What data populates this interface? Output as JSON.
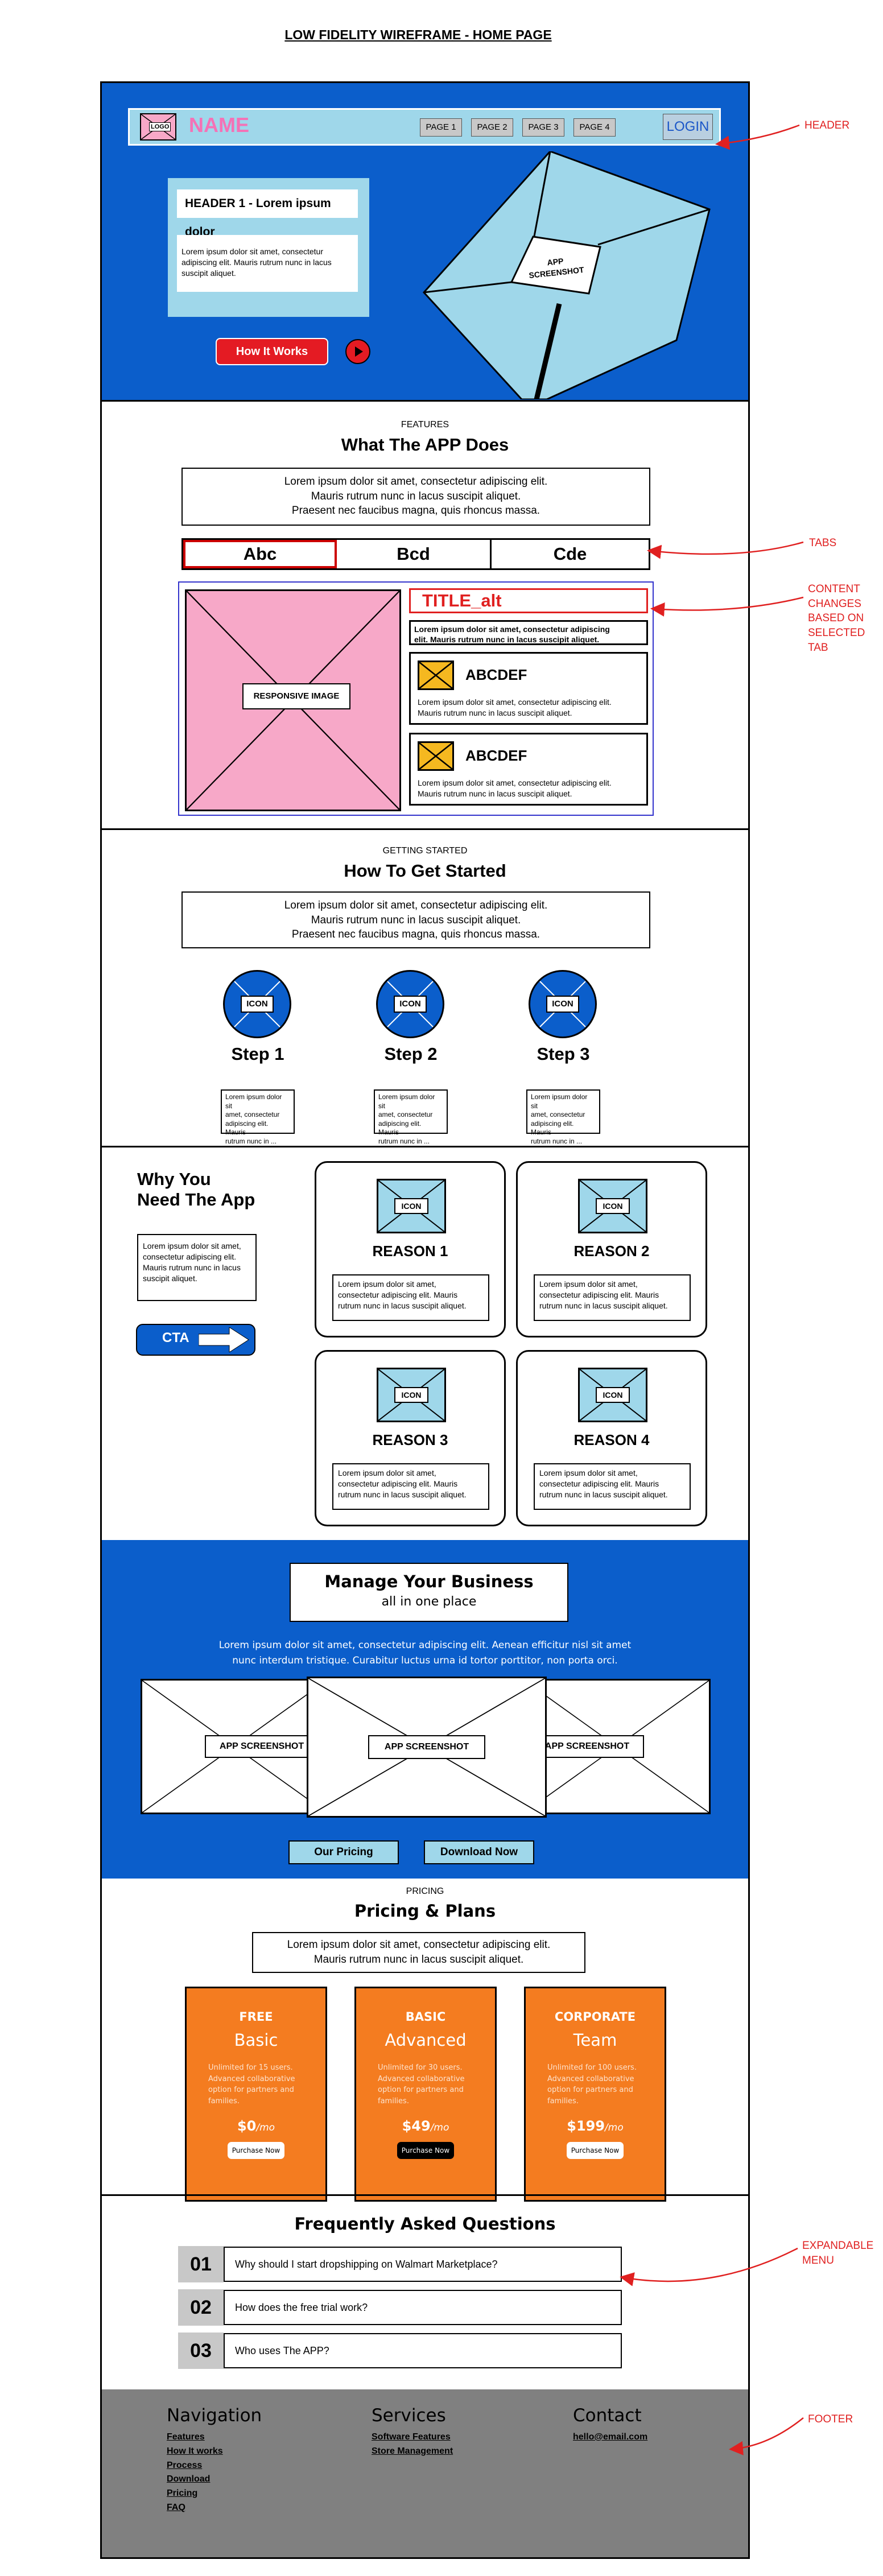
{
  "page_title": "LOW FIDELITY WIREFRAME - HOME PAGE",
  "colors": {
    "brand_blue": "#0b5ecb",
    "light_blue": "#9fd7ea",
    "pink": "#f7a8c8",
    "orange": "#f47c20",
    "annotation_red": "#e02020",
    "footer_gray": "#808080",
    "cta_red": "#e41b23"
  },
  "annotations": {
    "header": "HEADER",
    "tabs": "TABS",
    "content": [
      "CONTENT",
      "CHANGES",
      "BASED ON",
      "SELECTED",
      "TAB"
    ],
    "menu": [
      "EXPANDABLE",
      "MENU"
    ],
    "footer": "FOOTER"
  },
  "hero": {
    "logo": "LOGO",
    "name": "NAME",
    "nav": [
      "PAGE 1",
      "PAGE 2",
      "PAGE 3",
      "PAGE 4"
    ],
    "login": "LOGIN",
    "heading": "HEADER 1 - Lorem ipsum dolor",
    "body": "Lorem ipsum dolor sit amet, consectetur adipiscing elit. Mauris rutrum nunc in lacus suscipit aliquet.",
    "cta": "How It Works",
    "play_icon": "play-icon",
    "screenshot": [
      "APP",
      "SCREENSHOT"
    ]
  },
  "features": {
    "eyebrow": "FEATURES",
    "title": "What The APP Does",
    "intro": [
      "Lorem ipsum dolor sit amet, consectetur adipiscing elit.",
      "Mauris rutrum nunc in lacus suscipit aliquet.",
      "Praesent nec faucibus magna, quis rhoncus massa."
    ],
    "tabs": [
      "Abc",
      "Bcd",
      "Cde"
    ],
    "image_label": "RESPONSIVE IMAGE",
    "alt_title": "TITLE_alt",
    "alt_body": [
      "Lorem ipsum dolor sit amet, consectetur adipiscing",
      "elit. Mauris rutrum nunc in lacus suscipit aliquet."
    ],
    "items": [
      {
        "title": "ABCDEF",
        "body": [
          "Lorem ipsum dolor sit amet, consectetur adipiscing elit.",
          "Mauris rutrum nunc in lacus suscipit aliquet."
        ]
      },
      {
        "title": "ABCDEF",
        "body": [
          "Lorem ipsum dolor sit amet, consectetur adipiscing elit.",
          "Mauris rutrum nunc in lacus suscipit aliquet."
        ]
      }
    ]
  },
  "started": {
    "eyebrow": "GETTING STARTED",
    "title": "How To Get Started",
    "intro": [
      "Lorem ipsum dolor sit amet, consectetur adipiscing elit.",
      "Mauris rutrum nunc in lacus suscipit aliquet.",
      "Praesent nec faucibus magna, quis rhoncus massa."
    ],
    "icon_label": "ICON",
    "steps": [
      "Step 1",
      "Step 2",
      "Step 3"
    ],
    "step_body": [
      "Lorem ipsum dolor sit",
      "amet, consectetur",
      "adipiscing elit. Mauris",
      "rutrum nunc in ..."
    ]
  },
  "why": {
    "title": [
      "Why You",
      "Need The App"
    ],
    "body": [
      "Lorem ipsum dolor sit amet,",
      "consectetur adipiscing elit.",
      "Mauris rutrum nunc in lacus",
      "suscipit aliquet."
    ],
    "cta": "CTA",
    "icon_label": "ICON",
    "reasons": [
      "REASON 1",
      "REASON 2",
      "REASON 3",
      "REASON 4"
    ],
    "reason_body": [
      "Lorem ipsum dolor sit amet,",
      "consectetur adipiscing elit. Mauris",
      "rutrum nunc in lacus suscipit aliquet."
    ]
  },
  "manage": {
    "title": "Manage Your Business",
    "subtitle": "all in one place",
    "body": [
      "Lorem ipsum dolor sit amet, consectetur adipiscing elit. Aenean efficitur nisl sit amet",
      "nunc interdum tristique. Curabitur luctus urna id tortor porttitor, non porta orci."
    ],
    "screens": [
      "APP SCREENSHOT",
      "APP SCREENSHOT",
      "APP SCREENSHOT"
    ],
    "buttons": [
      "Our Pricing",
      "Download Now"
    ]
  },
  "pricing": {
    "eyebrow": "PRICING",
    "title": "Pricing & Plans",
    "intro": [
      "Lorem ipsum dolor sit amet, consectetur adipiscing elit.",
      "Mauris rutrum nunc in lacus suscipit aliquet."
    ],
    "plans": [
      {
        "tier": "FREE",
        "name": "Basic",
        "desc": [
          "Unlimited for 15 users.",
          "Advanced collaborative",
          "option for partners and",
          "families."
        ],
        "price": "$0",
        "per": "/mo",
        "button": "Purchase Now",
        "dark": false
      },
      {
        "tier": "BASIC",
        "name": "Advanced",
        "desc": [
          "Unlimited for 30 users.",
          "Advanced collaborative",
          "option for partners and",
          "families."
        ],
        "price": "$49",
        "per": "/mo",
        "button": "Purchase Now",
        "dark": true
      },
      {
        "tier": "CORPORATE",
        "name": "Team",
        "desc": [
          "Unlimited for 100 users.",
          "Advanced collaborative",
          "option for partners and",
          "families."
        ],
        "price": "$199",
        "per": "/mo",
        "button": "Purchase Now",
        "dark": false
      }
    ]
  },
  "faq": {
    "title": "Frequently Asked Questions",
    "items": [
      {
        "num": "01",
        "q": "Why should I start dropshipping on Walmart Marketplace?"
      },
      {
        "num": "02",
        "q": "How does the free trial work?"
      },
      {
        "num": "03",
        "q": "Who uses The APP?"
      }
    ]
  },
  "footer": {
    "nav_title": "Navigation",
    "nav_links": [
      "Features",
      "How It works",
      "Process",
      "Download",
      "Pricing",
      "FAQ"
    ],
    "services_title": "Services",
    "services_links": [
      "Software Features",
      "Store Management"
    ],
    "contact_title": "Contact",
    "email": "hello@email.com"
  }
}
